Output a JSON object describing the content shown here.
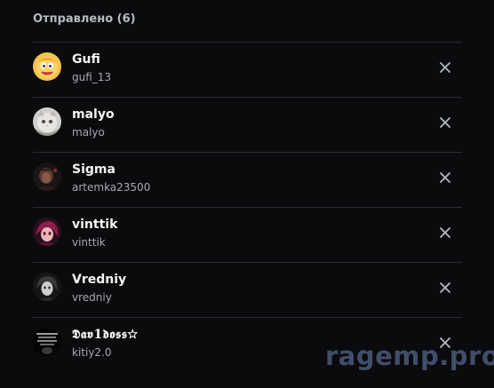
{
  "section": {
    "title": "Отправлено (6)"
  },
  "requests": [
    {
      "display_name": "Gufi",
      "username": "gufi_13",
      "avatar": "cartoon-face-avatar",
      "cancel_icon": "close-icon"
    },
    {
      "display_name": "malyo",
      "username": "malyo",
      "avatar": "cat-avatar",
      "cancel_icon": "close-icon"
    },
    {
      "display_name": "Sigma",
      "username": "artemka23500",
      "avatar": "dark-portrait-avatar",
      "cancel_icon": "close-icon"
    },
    {
      "display_name": "vinttik",
      "username": "vinttik",
      "avatar": "anime-avatar",
      "cancel_icon": "close-icon"
    },
    {
      "display_name": "Vredniy",
      "username": "vredniy",
      "avatar": "grayscale-portrait-avatar",
      "cancel_icon": "close-icon"
    },
    {
      "display_name": "𝕯𝖆𝖛1𝖉𝖔𝖘𝖘☆",
      "username": "kitiy2.0",
      "avatar": "text-collage-avatar",
      "cancel_icon": "close-icon"
    }
  ],
  "watermark": "ragemp.pro",
  "colors": {
    "background": "#0b0b0d",
    "divider": "#2a2b30",
    "name": "#f2f3f5",
    "username": "#a5a9b0",
    "icon": "#b5bac1"
  }
}
